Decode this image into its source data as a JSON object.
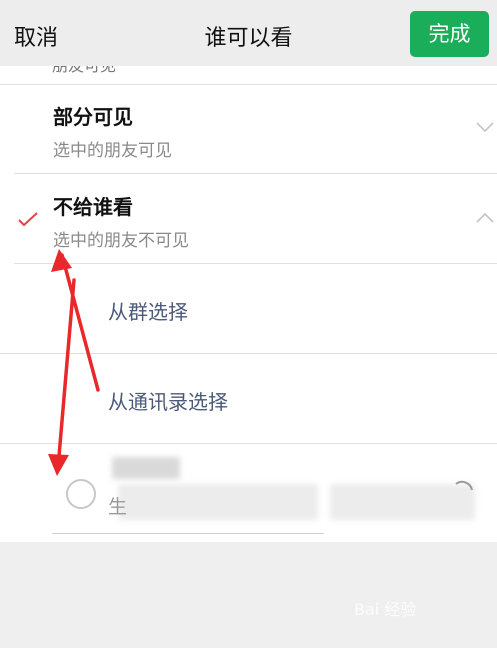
{
  "header": {
    "cancel_label": "取消",
    "title": "谁可以看",
    "done_label": "完成",
    "done_color": "#1aad5a"
  },
  "options": {
    "partial_hidden_text": "朋友可见",
    "partial_visible": {
      "title": "部分可见",
      "subtitle": "选中的朋友可见",
      "chevron": "chevron-down-icon"
    },
    "exclude": {
      "title": "不给谁看",
      "subtitle": "选中的朋友不可见",
      "selected": true,
      "chevron": "chevron-up-icon",
      "check_color": "#e64340"
    }
  },
  "sub_options": {
    "from_group": "从群选择",
    "from_contacts": "从通讯录选择"
  },
  "contact_row": {
    "first_char": "生"
  },
  "annotation": {
    "arrow_color": "#e8282a"
  },
  "watermark": {
    "text": "Bai 经验"
  }
}
